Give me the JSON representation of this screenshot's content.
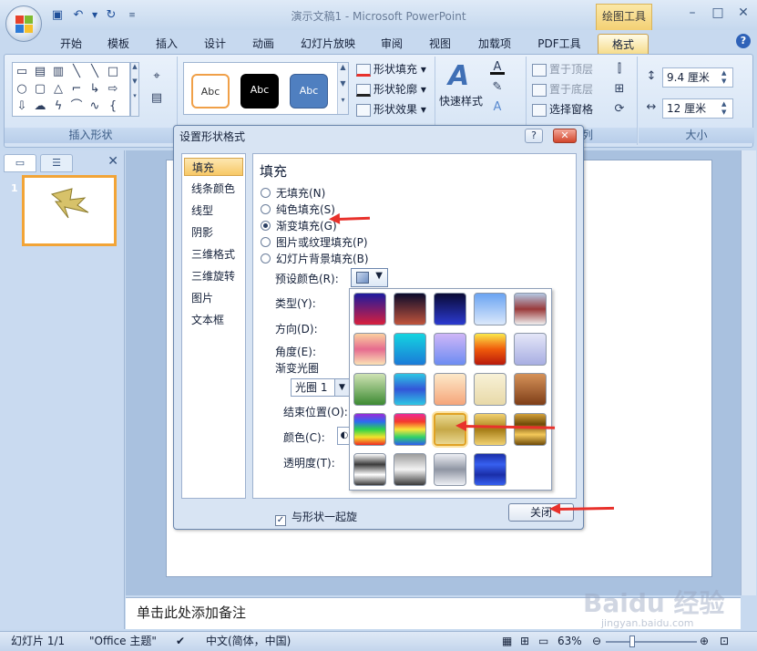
{
  "window": {
    "title": "演示文稿1 - Microsoft PowerPoint",
    "context_tab_group": "绘图工具"
  },
  "ribbon": {
    "tabs": [
      "开始",
      "模板",
      "插入",
      "设计",
      "动画",
      "幻灯片放映",
      "审阅",
      "视图",
      "加载项",
      "PDF工具",
      "格式"
    ],
    "active_tab": "格式",
    "groups": {
      "insert_shapes": "插入形状",
      "shape_styles_partial": "列",
      "size": "大小"
    },
    "style_thumbs": [
      "Abc",
      "Abc",
      "Abc"
    ],
    "shape_fill": "形状填充",
    "shape_outline": "形状轮廓",
    "shape_effects": "形状效果",
    "quick_styles": "快速样式",
    "bring_front": "置于顶层",
    "send_back": "置于底层",
    "selection_pane": "选择窗格",
    "height": "9.4 厘米",
    "width": "12 厘米"
  },
  "slide_panel": {
    "slide_number": "1"
  },
  "notes_placeholder": "单击此处添加备注",
  "status": {
    "slide": "幻灯片 1/1",
    "theme": "\"Office 主题\"",
    "language": "中文(简体，中国)",
    "zoom": "63%"
  },
  "watermark": {
    "main": "Baidu 经验",
    "sub": "jingyan.baidu.com"
  },
  "dialog": {
    "title": "设置形状格式",
    "help_label": "?",
    "close_label": "✕",
    "nav": [
      "填充",
      "线条颜色",
      "线型",
      "阴影",
      "三维格式",
      "三维旋转",
      "图片",
      "文本框"
    ],
    "selected_nav": "填充",
    "section_title": "填充",
    "fill_options": [
      "无填充(N)",
      "纯色填充(S)",
      "渐变填充(G)",
      "图片或纹理填充(P)",
      "幻灯片背景填充(B)"
    ],
    "selected_fill": "渐变填充(G)",
    "preset_label": "预设颜色(R):",
    "type_label": "类型(Y):",
    "direction_label": "方向(D):",
    "angle_label": "角度(E):",
    "stops_label": "渐变光圈",
    "stop_value": "光圈 1",
    "end_position_label": "结束位置(O):",
    "color_label": "颜色(C):",
    "transparency_label": "透明度(T):",
    "rotate_checkbox": "与形状一起旋",
    "rotate_checked": true,
    "close_button": "关闭"
  },
  "gradient_presets": [
    {
      "name": "early-sunset",
      "colors": [
        "#1d1a9e",
        "#d81f3d"
      ]
    },
    {
      "name": "late-sunset",
      "colors": [
        "#0b0b2b",
        "#c1543b"
      ]
    },
    {
      "name": "nightfall",
      "colors": [
        "#0a0a35",
        "#2b3ad0"
      ]
    },
    {
      "name": "daybreak",
      "colors": [
        "#6aa4f2",
        "#dbe8fb"
      ]
    },
    {
      "name": "horizon",
      "colors": [
        "#b4c8e3",
        "#9a3a3a",
        "#f0f0f0"
      ]
    },
    {
      "name": "desert",
      "colors": [
        "#fbd0a0",
        "#e66b8f",
        "#fbe2b5"
      ]
    },
    {
      "name": "ocean",
      "colors": [
        "#15d4e0",
        "#1a7ad8"
      ]
    },
    {
      "name": "calm-water",
      "colors": [
        "#cfb6f7",
        "#6c8cf2"
      ]
    },
    {
      "name": "fire",
      "colors": [
        "#fbe84a",
        "#f05b0b",
        "#b8190b"
      ]
    },
    {
      "name": "fog",
      "colors": [
        "#e4e6f8",
        "#a8aee2"
      ]
    },
    {
      "name": "moss",
      "colors": [
        "#cfe3b3",
        "#3d8a33"
      ]
    },
    {
      "name": "peacock",
      "colors": [
        "#2ec7e4",
        "#3355d8",
        "#2ec7e4"
      ]
    },
    {
      "name": "wheat",
      "colors": [
        "#fde9c9",
        "#f5a57a"
      ]
    },
    {
      "name": "parchment",
      "colors": [
        "#f8f1d7",
        "#e8d9a8"
      ]
    },
    {
      "name": "mahogany",
      "colors": [
        "#d69259",
        "#7e3e18"
      ]
    },
    {
      "name": "rainbow",
      "colors": [
        "#9b2bd8",
        "#2c6bf0",
        "#2dd34a",
        "#f3e32b",
        "#ef2a21"
      ]
    },
    {
      "name": "rainbow-ii",
      "colors": [
        "#ec2a96",
        "#f43b2c",
        "#fbe43a",
        "#2ed16a",
        "#2d5bf0"
      ]
    },
    {
      "name": "gold",
      "colors": [
        "#e9d891",
        "#c6a847",
        "#e9d891"
      ]
    },
    {
      "name": "gold-ii",
      "colors": [
        "#f2d271",
        "#a57c16",
        "#f2d271"
      ]
    },
    {
      "name": "brass",
      "colors": [
        "#d3a13b",
        "#6e4a08",
        "#f4c95a",
        "#6e4a08"
      ]
    },
    {
      "name": "chrome",
      "colors": [
        "#ffffff",
        "#3b3b3b",
        "#ffffff",
        "#3b3b3b"
      ]
    },
    {
      "name": "chrome-ii",
      "colors": [
        "#9c9c9c",
        "#f3f3f3",
        "#3a3a3a"
      ]
    },
    {
      "name": "silver",
      "colors": [
        "#eef0f5",
        "#8f95a3",
        "#eef0f5"
      ]
    },
    {
      "name": "sapphire",
      "colors": [
        "#1a2ea8",
        "#3760f0",
        "#1a2ea8",
        "#3760f0"
      ]
    }
  ],
  "selected_preset": "gold"
}
